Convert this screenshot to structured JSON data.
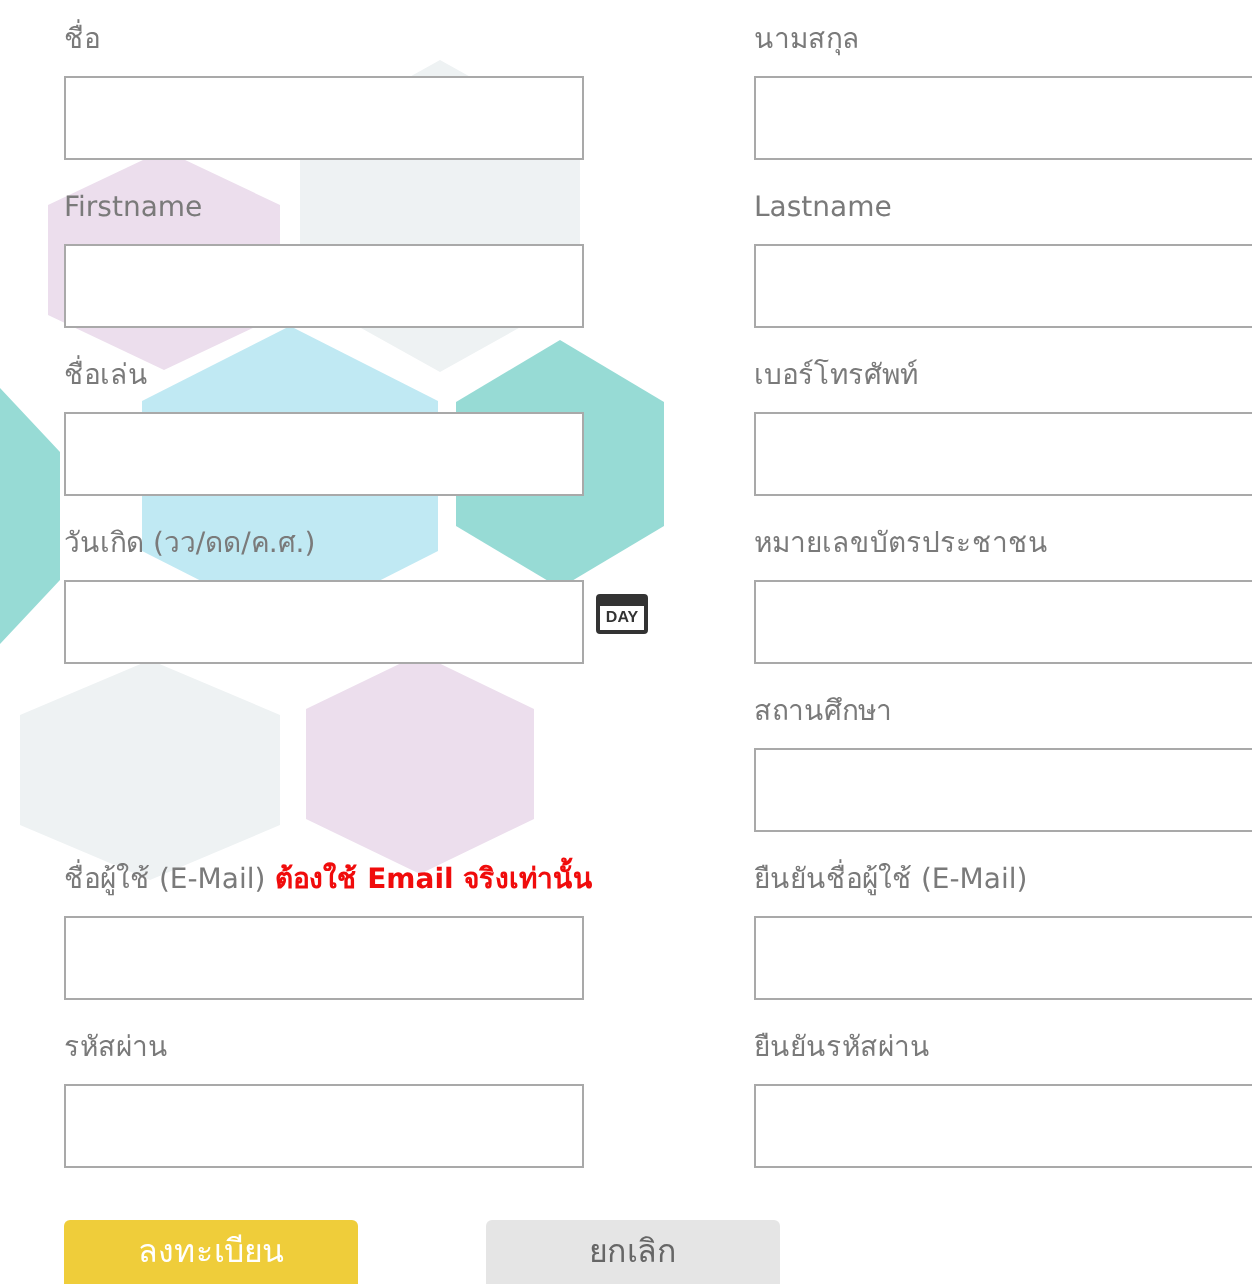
{
  "rows": [
    {
      "left": {
        "label": "ชื่อ"
      },
      "right": {
        "label": "นามสกุล"
      }
    },
    {
      "left": {
        "label": "Firstname"
      },
      "right": {
        "label": "Lastname"
      }
    },
    {
      "left": {
        "label": "ชื่อเล่น"
      },
      "right": {
        "label": "เบอร์โทรศัพท์"
      }
    },
    {
      "left": {
        "label": "วันเกิด (วว/ดด/ค.ศ.)",
        "kind": "date",
        "picker": "DAY"
      },
      "right": {
        "label": "หมายเลขบัตรประชาชน"
      }
    },
    {
      "right": {
        "label": "สถานศึกษา"
      }
    },
    {
      "left": {
        "label": "ชื่อผู้ใช้ (E-Mail)",
        "note": "ต้องใช้ Email จริงเท่านั้น"
      },
      "right": {
        "label": "ยืนยันชื่อผู้ใช้ (E-Mail)"
      }
    },
    {
      "left": {
        "label": "รหัสผ่าน"
      },
      "right": {
        "label": "ยืนยันรหัสผ่าน"
      }
    }
  ],
  "buttons": [
    {
      "label": "ลงทะเบียน",
      "kind": "primary"
    },
    {
      "label": "ยกเลิก",
      "kind": "secondary"
    }
  ]
}
